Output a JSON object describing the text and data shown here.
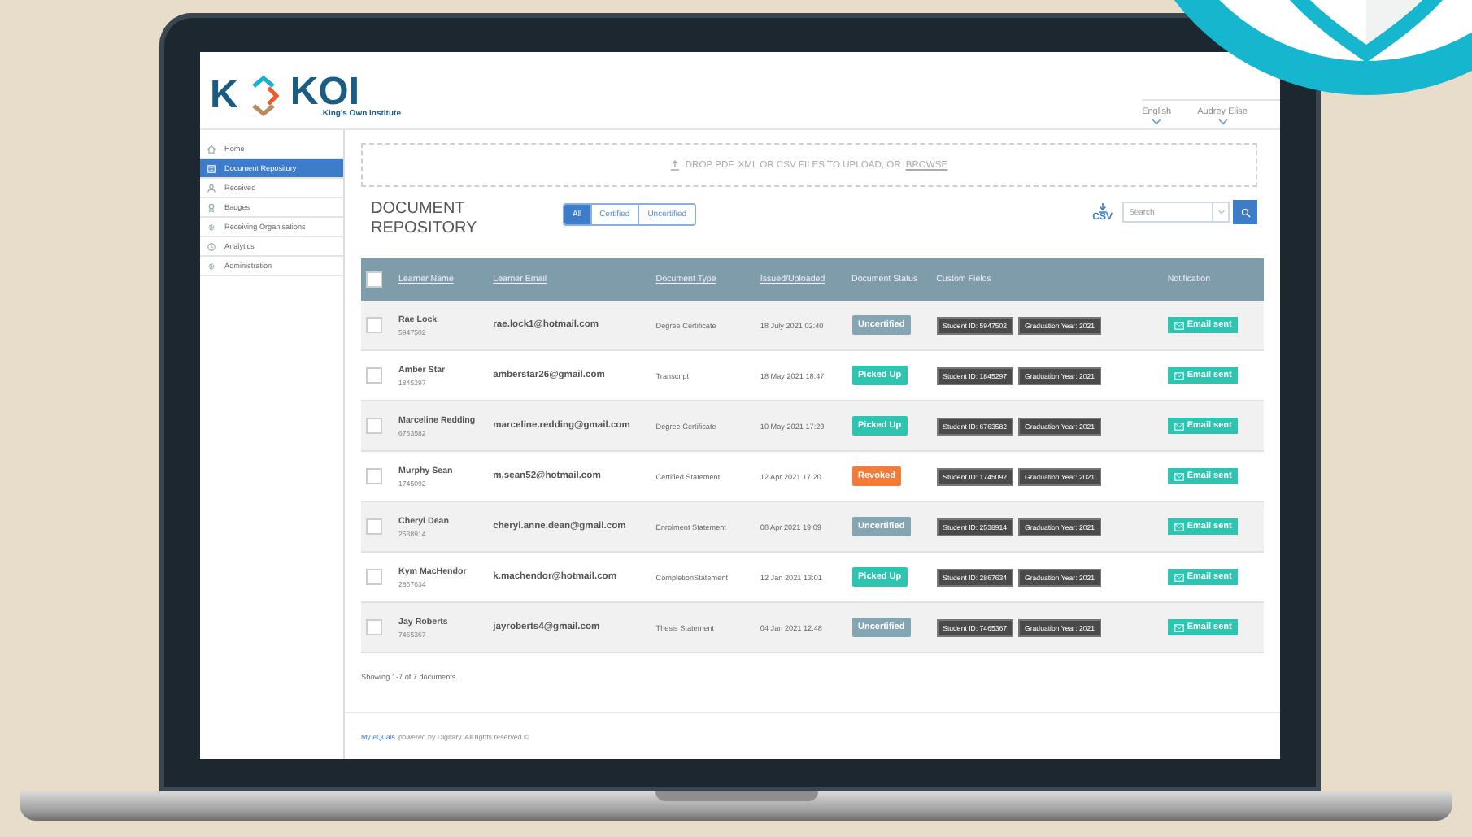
{
  "logo": {
    "letter": "K",
    "name": "KOI",
    "tagline": "King's Own Institute"
  },
  "header": {
    "language": "English",
    "user": "Audrey Elise"
  },
  "sidebar": {
    "items": [
      {
        "label": "Home",
        "selected": false
      },
      {
        "label": "Document Repository",
        "selected": true
      },
      {
        "label": "Received",
        "selected": false
      },
      {
        "label": "Badges",
        "selected": false
      },
      {
        "label": "Receiving Organisations",
        "selected": false
      },
      {
        "label": "Analytics",
        "selected": false
      },
      {
        "label": "Administration",
        "selected": false
      }
    ]
  },
  "dropzone": {
    "text": "DROP PDF, XML OR CSV FILES TO UPLOAD, OR",
    "link": "BROWSE"
  },
  "title": "DOCUMENT REPOSITORY",
  "filters": [
    {
      "label": "All",
      "selected": true
    },
    {
      "label": "Certified",
      "selected": false
    },
    {
      "label": "Uncertified",
      "selected": false
    }
  ],
  "csv": {
    "label": "CSV"
  },
  "search": {
    "placeholder": "Search"
  },
  "table": {
    "header_checked": false,
    "columns": [
      {
        "label": "Learner Name",
        "sortable": true
      },
      {
        "label": "Learner Email",
        "sortable": true
      },
      {
        "label": "Document Type",
        "sortable": true
      },
      {
        "label": "Issued/Uploaded",
        "sortable": true
      },
      {
        "label": "Document Status",
        "sortable": false
      },
      {
        "label": "Custom Fields",
        "sortable": false
      },
      {
        "label": "Notification",
        "sortable": false
      }
    ],
    "rows": [
      {
        "checked": false,
        "name": "Rae Lock",
        "id": "5947502",
        "email": "rae.lock1@hotmail.com",
        "type": "Degree Certificate",
        "date": "18 July 2021 02:40",
        "status": {
          "label": "Uncertified",
          "kind": "uncertified"
        },
        "fields": [
          "Student ID: 5947502",
          "Graduation Year: 2021"
        ],
        "notification": "Email sent"
      },
      {
        "checked": false,
        "name": "Amber Star",
        "id": "1845297",
        "email": "amberstar26@gmail.com",
        "type": "Transcript",
        "date": "18 May 2021 18:47",
        "status": {
          "label": "Picked Up",
          "kind": "picked"
        },
        "fields": [
          "Student ID: 1845297",
          "Graduation Year: 2021"
        ],
        "notification": "Email sent"
      },
      {
        "checked": false,
        "name": "Marceline Redding",
        "id": "6763582",
        "email": "marceline.redding@gmail.com",
        "type": "Degree Certificate",
        "date": "10 May 2021 17:29",
        "status": {
          "label": "Picked Up",
          "kind": "picked"
        },
        "fields": [
          "Student ID: 6763582",
          "Graduation Year: 2021"
        ],
        "notification": "Email sent"
      },
      {
        "checked": false,
        "name": "Murphy Sean",
        "id": "1745092",
        "email": "m.sean52@hotmail.com",
        "type": "Certified Statement",
        "date": "12 Apr 2021 17:20",
        "status": {
          "label": "Revoked",
          "kind": "revoked"
        },
        "fields": [
          "Student ID: 1745092",
          "Graduation Year: 2021"
        ],
        "notification": "Email sent"
      },
      {
        "checked": false,
        "name": "Cheryl Dean",
        "id": "2538914",
        "email": "cheryl.anne.dean@gmail.com",
        "type": "Enrolment Statement",
        "date": "08 Apr 2021 19:09",
        "status": {
          "label": "Uncertified",
          "kind": "uncertified"
        },
        "fields": [
          "Student ID: 2538914",
          "Graduation Year: 2021"
        ],
        "notification": "Email sent"
      },
      {
        "checked": false,
        "name": "Kym MacHendor",
        "id": "2867634",
        "email": "k.machendor@hotmail.com",
        "type": "CompletionStatement",
        "date": "12 Jan 2021 13:01",
        "status": {
          "label": "Picked Up",
          "kind": "picked"
        },
        "fields": [
          "Student ID: 2867634",
          "Graduation Year: 2021"
        ],
        "notification": "Email sent"
      },
      {
        "checked": false,
        "name": "Jay Roberts",
        "id": "7465367",
        "email": "jayroberts4@gmail.com",
        "type": "Thesis Statement",
        "date": "04 Jan 2021 12:48",
        "status": {
          "label": "Uncertified",
          "kind": "uncertified"
        },
        "fields": [
          "Student ID: 7465367",
          "Graduation Year: 2021"
        ],
        "notification": "Email sent"
      }
    ]
  },
  "summary": "Showing 1-7 of 7 documents.",
  "footer": {
    "link": "My eQuals",
    "text": "powered by Digitary. All rights reserved ©"
  }
}
